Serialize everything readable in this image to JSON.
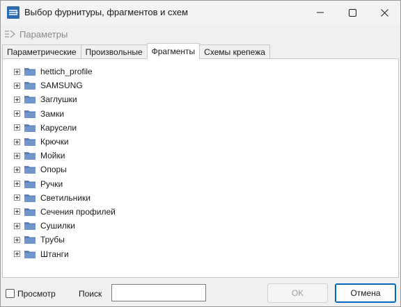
{
  "window": {
    "title": "Выбор фурнитуры, фрагментов и схем"
  },
  "toolbar": {
    "params_label": "Параметры"
  },
  "tabs": [
    {
      "label": "Параметрические",
      "active": false
    },
    {
      "label": "Произвольные",
      "active": false
    },
    {
      "label": "Фрагменты",
      "active": true
    },
    {
      "label": "Схемы крепежа",
      "active": false
    }
  ],
  "tree": {
    "items": [
      {
        "label": "hettich_profile"
      },
      {
        "label": "SAMSUNG"
      },
      {
        "label": "Заглушки"
      },
      {
        "label": "Замки"
      },
      {
        "label": "Карусели"
      },
      {
        "label": "Крючки"
      },
      {
        "label": "Мойки"
      },
      {
        "label": "Опоры"
      },
      {
        "label": "Ручки"
      },
      {
        "label": "Светильники"
      },
      {
        "label": "Сечения профилей"
      },
      {
        "label": "Сушилки"
      },
      {
        "label": "Трубы"
      },
      {
        "label": "Штанги"
      }
    ]
  },
  "footer": {
    "preview_label": "Просмотр",
    "preview_checked": false,
    "search_label": "Поиск",
    "search_value": "",
    "ok_label": "OK",
    "ok_enabled": false,
    "cancel_label": "Отмена"
  },
  "colors": {
    "accent": "#0067c0",
    "folder": "#5b7fb5",
    "app_icon": "#2b6cb0"
  }
}
